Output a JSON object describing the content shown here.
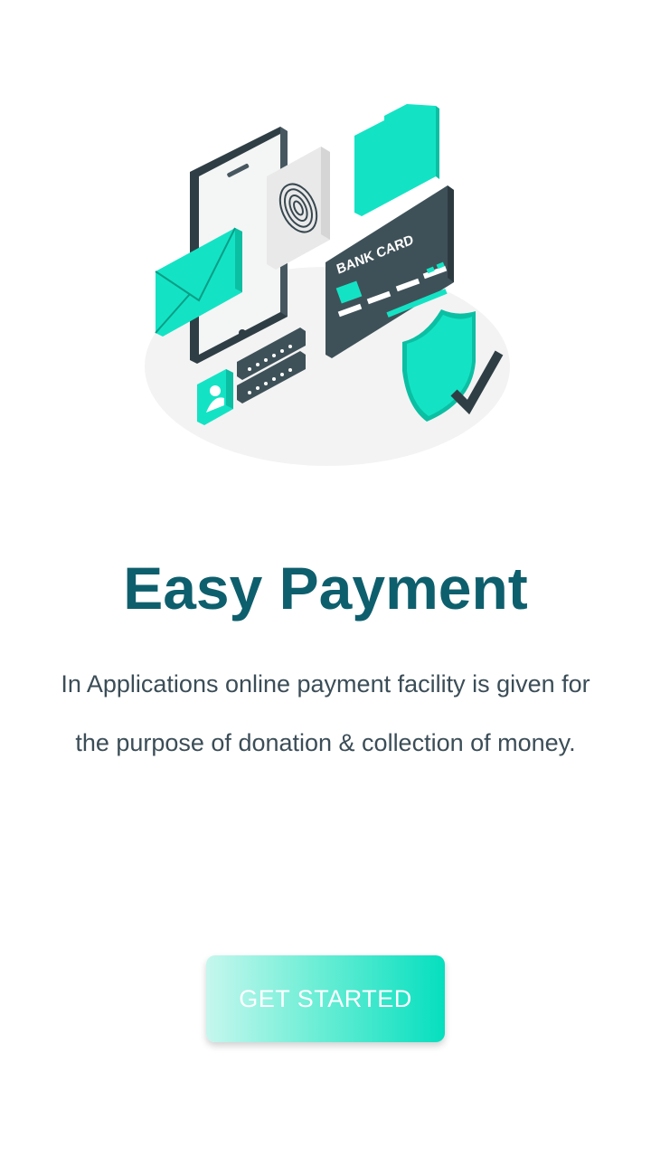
{
  "illustration": {
    "card_text": "BANK CARD",
    "icons": [
      "smartphone-icon",
      "fingerprint-icon",
      "folder-icon",
      "envelope-icon",
      "bank-card-icon",
      "shield-check-icon",
      "user-badge-icon",
      "password-field-icon"
    ],
    "colors": {
      "accent": "#0fe0c0",
      "accent_dark": "#0bbfa3",
      "dark": "#37474f",
      "shadow": "#f3f3f3"
    }
  },
  "title": "Easy Payment",
  "description": "In Applications online payment facility is given for the purpose of donation & collection of money.",
  "cta": {
    "label": "GET STARTED"
  },
  "colors": {
    "title": "#0e5f6d",
    "text": "#3b4d57",
    "button_start": "#c6f7ee",
    "button_end": "#05dfbf"
  }
}
